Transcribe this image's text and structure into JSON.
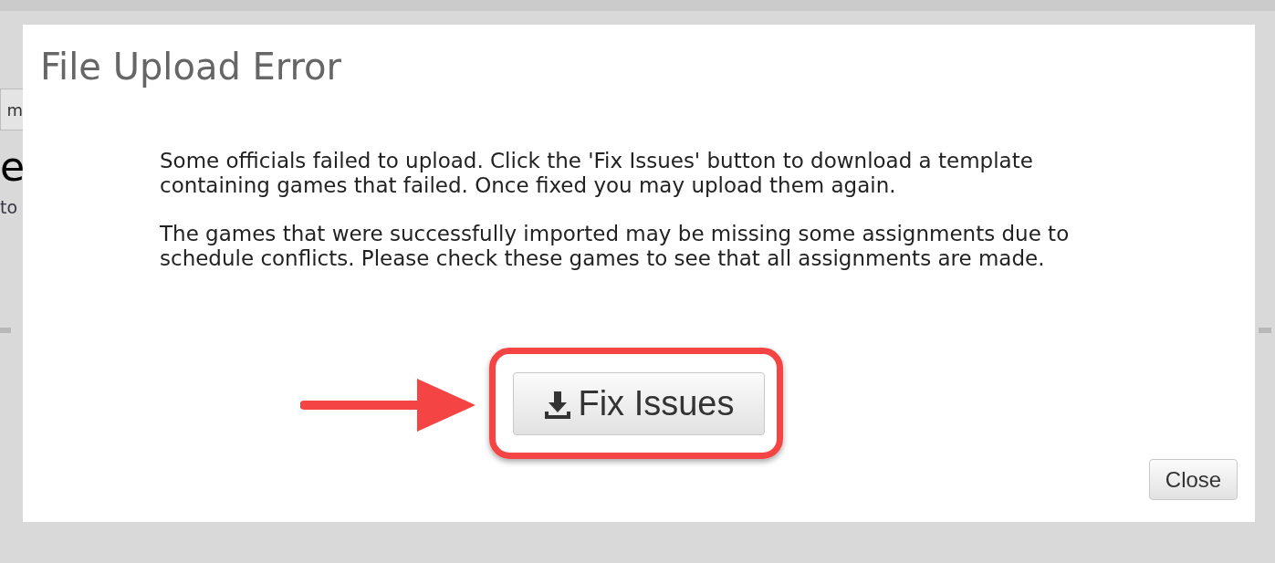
{
  "background": {
    "button_fragment": "m",
    "heading_fragment": "e",
    "text_fragment": "to"
  },
  "dialog": {
    "title": "File Upload Error",
    "paragraphs": [
      "Some officials failed to upload. Click the 'Fix Issues' button to download a template containing games that failed. Once fixed you may upload them again.",
      "The games that were successfully imported may be missing some assignments due to schedule conflicts. Please check these games to see that all assignments are made."
    ],
    "fix_button": "Fix Issues",
    "close_button": "Close"
  }
}
